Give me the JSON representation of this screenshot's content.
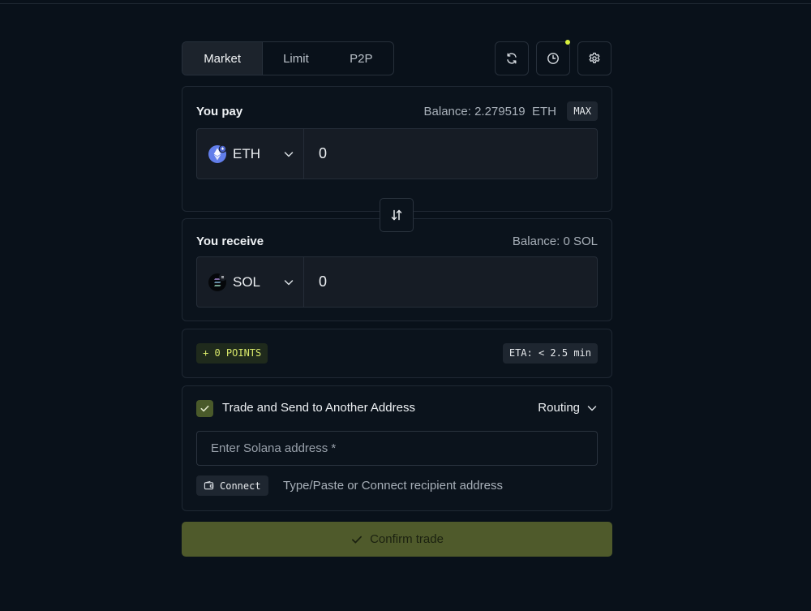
{
  "tabs": [
    {
      "label": "Market",
      "active": true
    },
    {
      "label": "Limit",
      "active": false
    },
    {
      "label": "P2P",
      "active": false
    }
  ],
  "toolbar": {
    "refresh_icon": "refresh-icon",
    "history_icon": "clock-icon",
    "settings_icon": "gear-icon",
    "history_has_notification": true
  },
  "pay": {
    "label": "You pay",
    "balance_label": "Balance:",
    "balance_value": "2.279519",
    "balance_unit": "ETH",
    "max_label": "MAX",
    "token": "ETH",
    "amount": "0"
  },
  "receive": {
    "label": "You receive",
    "balance_text": "Balance: 0 SOL",
    "token": "SOL",
    "amount": "0"
  },
  "info": {
    "points": "+ 0 POINTS",
    "eta": "ETA: < 2.5 min"
  },
  "send": {
    "checked": true,
    "label": "Trade and Send to Another Address",
    "routing_label": "Routing",
    "address_placeholder": "Enter Solana address *",
    "address_value": "",
    "connect_label": "Connect",
    "hint": "Type/Paste or Connect recipient address"
  },
  "confirm_label": "Confirm trade",
  "colors": {
    "background": "#09111a",
    "accent": "#d8f03c",
    "confirm_bg": "#4f5a2b",
    "eth": "#627eea"
  }
}
